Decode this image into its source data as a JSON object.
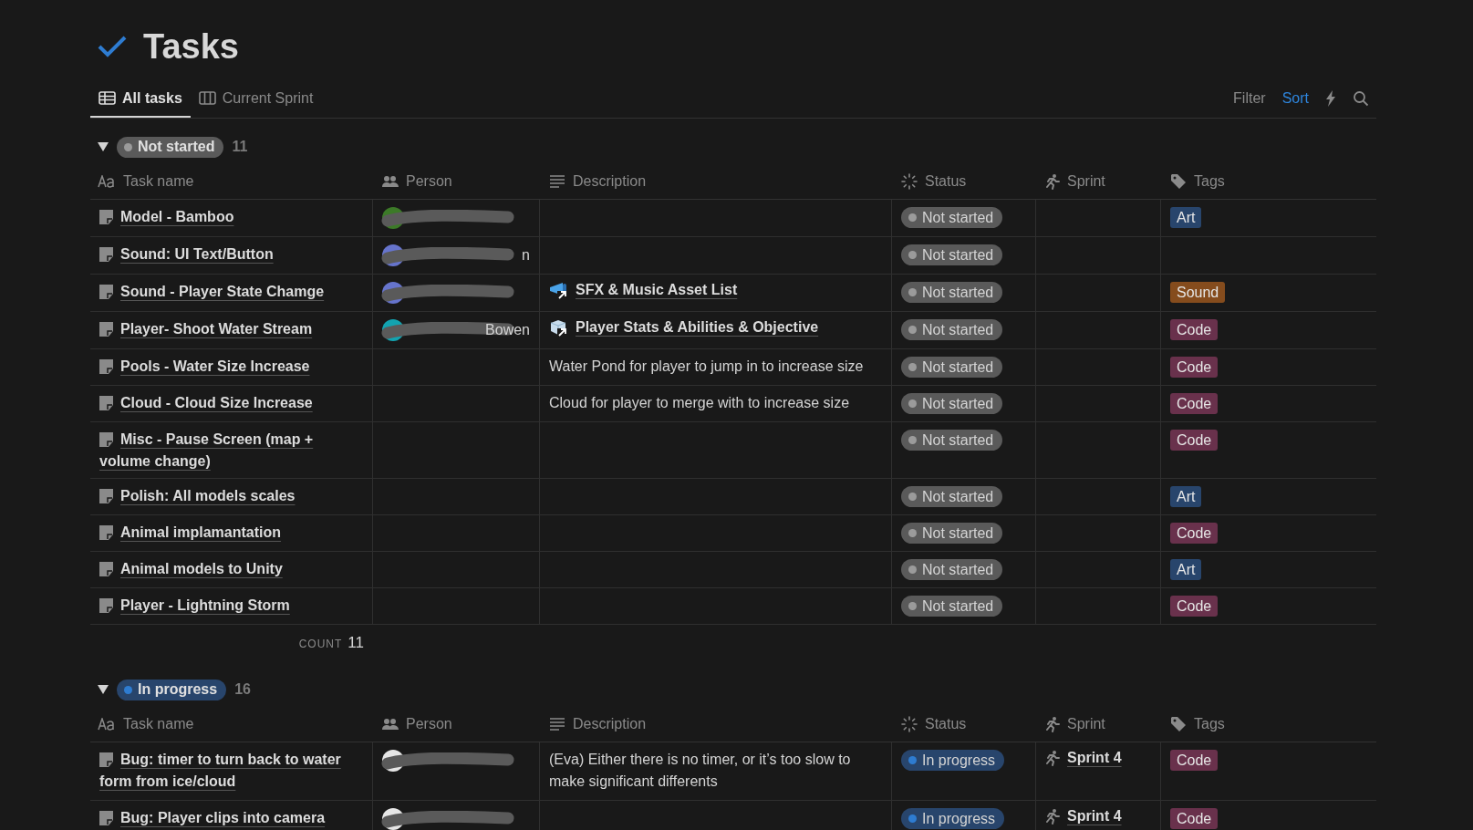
{
  "page": {
    "title": "Tasks"
  },
  "views": [
    {
      "label": "All tasks",
      "kind": "table",
      "selected": true
    },
    {
      "label": "Current Sprint",
      "kind": "board",
      "selected": false
    }
  ],
  "toolbar": [
    {
      "label": "Filter",
      "active": false
    },
    {
      "label": "Sort",
      "active": true
    }
  ],
  "groups": [
    {
      "status": "Not started",
      "kind": "not_started",
      "count": "11",
      "expanded": true,
      "columns": [
        {
          "label": "Task name",
          "kind": "title"
        },
        {
          "label": "Person",
          "kind": "person"
        },
        {
          "label": "Description",
          "kind": "text"
        },
        {
          "label": "Status",
          "kind": "status"
        },
        {
          "label": "Sprint",
          "kind": "sprint"
        },
        {
          "label": "Tags",
          "kind": "tags"
        }
      ],
      "rows": [
        {
          "name": "Model - Bamboo",
          "person": {
            "color": "#3c7a28"
          },
          "status": {
            "label": "Not started",
            "kind": "not_started"
          },
          "tags": [
            {
              "label": "Art",
              "color": "#28456c"
            }
          ]
        },
        {
          "name": "Sound: UI Text/Button",
          "person": {
            "color": "#6674cc",
            "visible_text": "n"
          },
          "status": {
            "label": "Not started",
            "kind": "not_started"
          }
        },
        {
          "name": "Sound - Player State Chamge",
          "person": {
            "color": "#6674cc"
          },
          "description": {
            "kind": "link",
            "text": "SFX & Music Asset List"
          },
          "status": {
            "label": "Not started",
            "kind": "not_started"
          },
          "tags": [
            {
              "label": "Sound",
              "color": "#854c1d"
            }
          ]
        },
        {
          "name": "Player- Shoot Water Stream",
          "person": {
            "color": "#13a3b0",
            "visible_text": "Bowen"
          },
          "description": {
            "kind": "link",
            "text": "Player Stats & Abilities & Objective"
          },
          "status": {
            "label": "Not started",
            "kind": "not_started"
          },
          "tags": [
            {
              "label": "Code",
              "color": "#69314c"
            }
          ]
        },
        {
          "name": "Pools - Water Size Increase",
          "description": {
            "kind": "text",
            "text": "Water Pond for player to jump in to increase size"
          },
          "status": {
            "label": "Not started",
            "kind": "not_started"
          },
          "tags": [
            {
              "label": "Code",
              "color": "#69314c"
            }
          ]
        },
        {
          "name": "Cloud - Cloud Size Increase",
          "description": {
            "kind": "text",
            "text": "Cloud for player to merge with to increase size"
          },
          "status": {
            "label": "Not started",
            "kind": "not_started"
          },
          "tags": [
            {
              "label": "Code",
              "color": "#69314c"
            }
          ]
        },
        {
          "name": "Misc - Pause Screen (map + volume change)",
          "status": {
            "label": "Not started",
            "kind": "not_started"
          },
          "tags": [
            {
              "label": "Code",
              "color": "#69314c"
            }
          ]
        },
        {
          "name": "Polish: All models scales",
          "status": {
            "label": "Not started",
            "kind": "not_started"
          },
          "tags": [
            {
              "label": "Art",
              "color": "#28456c"
            }
          ]
        },
        {
          "name": "Animal implamantation",
          "status": {
            "label": "Not started",
            "kind": "not_started"
          },
          "tags": [
            {
              "label": "Code",
              "color": "#69314c"
            }
          ]
        },
        {
          "name": "Animal models to Unity",
          "status": {
            "label": "Not started",
            "kind": "not_started"
          },
          "tags": [
            {
              "label": "Art",
              "color": "#28456c"
            }
          ]
        },
        {
          "name": "Player - Lightning Storm",
          "status": {
            "label": "Not started",
            "kind": "not_started"
          },
          "tags": [
            {
              "label": "Code",
              "color": "#69314c"
            }
          ]
        }
      ],
      "footer": {
        "label": "COUNT",
        "value": "11"
      }
    },
    {
      "status": "In progress",
      "kind": "in_progress",
      "count": "16",
      "expanded": true,
      "columns": [
        {
          "label": "Task name",
          "kind": "title"
        },
        {
          "label": "Person",
          "kind": "person"
        },
        {
          "label": "Description",
          "kind": "text"
        },
        {
          "label": "Status",
          "kind": "status"
        },
        {
          "label": "Sprint",
          "kind": "sprint"
        },
        {
          "label": "Tags",
          "kind": "tags"
        }
      ],
      "rows": [
        {
          "name": "Bug: timer to turn back to water form from ice/cloud",
          "person": {
            "color": "#e6e6e6"
          },
          "description": {
            "kind": "text",
            "text": "(Eva) Either there is no timer, or it’s too slow to make significant differents"
          },
          "status": {
            "label": "In progress",
            "kind": "in_progress"
          },
          "sprint": "Sprint 4",
          "tags": [
            {
              "label": "Code",
              "color": "#69314c"
            }
          ]
        },
        {
          "name": "Bug: Player clips into camera",
          "person": {
            "color": "#e6e6e6"
          },
          "status": {
            "label": "In progress",
            "kind": "in_progress"
          },
          "sprint": "Sprint 4",
          "tags": [
            {
              "label": "Code",
              "color": "#69314c"
            }
          ]
        }
      ]
    }
  ]
}
